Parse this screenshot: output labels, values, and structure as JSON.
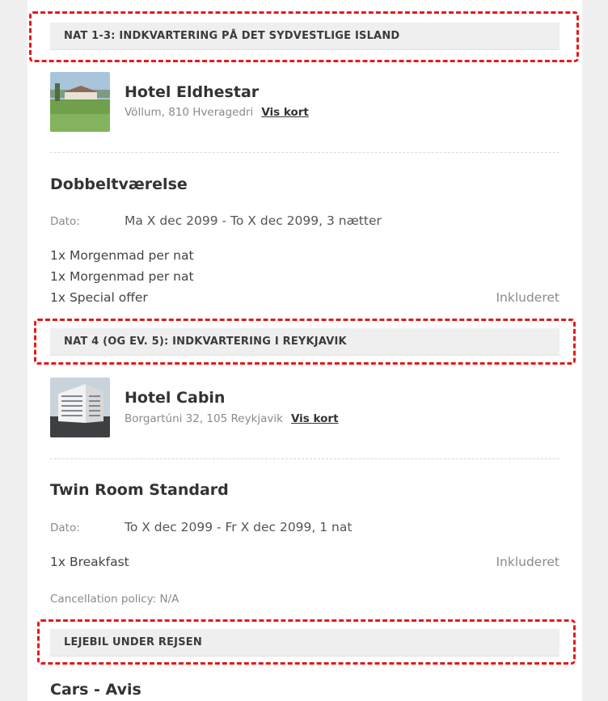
{
  "sections": [
    {
      "heading": "NAT 1-3: INDKVARTERING PÅ DET SYDVESTLIGE ISLAND"
    },
    {
      "heading": "NAT 4 (OG EV. 5): INDKVARTERING I REYKJAVIK"
    },
    {
      "heading": "LEJEBIL UNDER REJSEN"
    }
  ],
  "hotel1": {
    "name": "Hotel Eldhestar",
    "address": "Völlum, 810 Hveragedri",
    "map_link": "Vis kort",
    "room": "Dobbeltværelse",
    "date_label": "Dato:",
    "date": "Ma X dec 2099 - To X dec 2099, 3 nætter",
    "items": [
      "1x Morgenmad per nat",
      "1x Morgenmad per nat",
      "1x Special offer"
    ],
    "included": "Inkluderet"
  },
  "hotel2": {
    "name": "Hotel Cabin",
    "address": "Borgartúni 32, 105 Reykjavik",
    "map_link": "Vis kort",
    "room": "Twin Room Standard",
    "date_label": "Dato:",
    "date": "To X dec 2099 - Fr X dec 2099, 1 nat",
    "items": [
      "1x Breakfast"
    ],
    "included": "Inkluderet",
    "cancellation": "Cancellation policy: N/A"
  },
  "car": {
    "title": "Cars - Avis"
  },
  "colors": {
    "highlight": "#e11b1b",
    "band_bg": "#efefef",
    "muted_text": "#8a8a8a"
  }
}
